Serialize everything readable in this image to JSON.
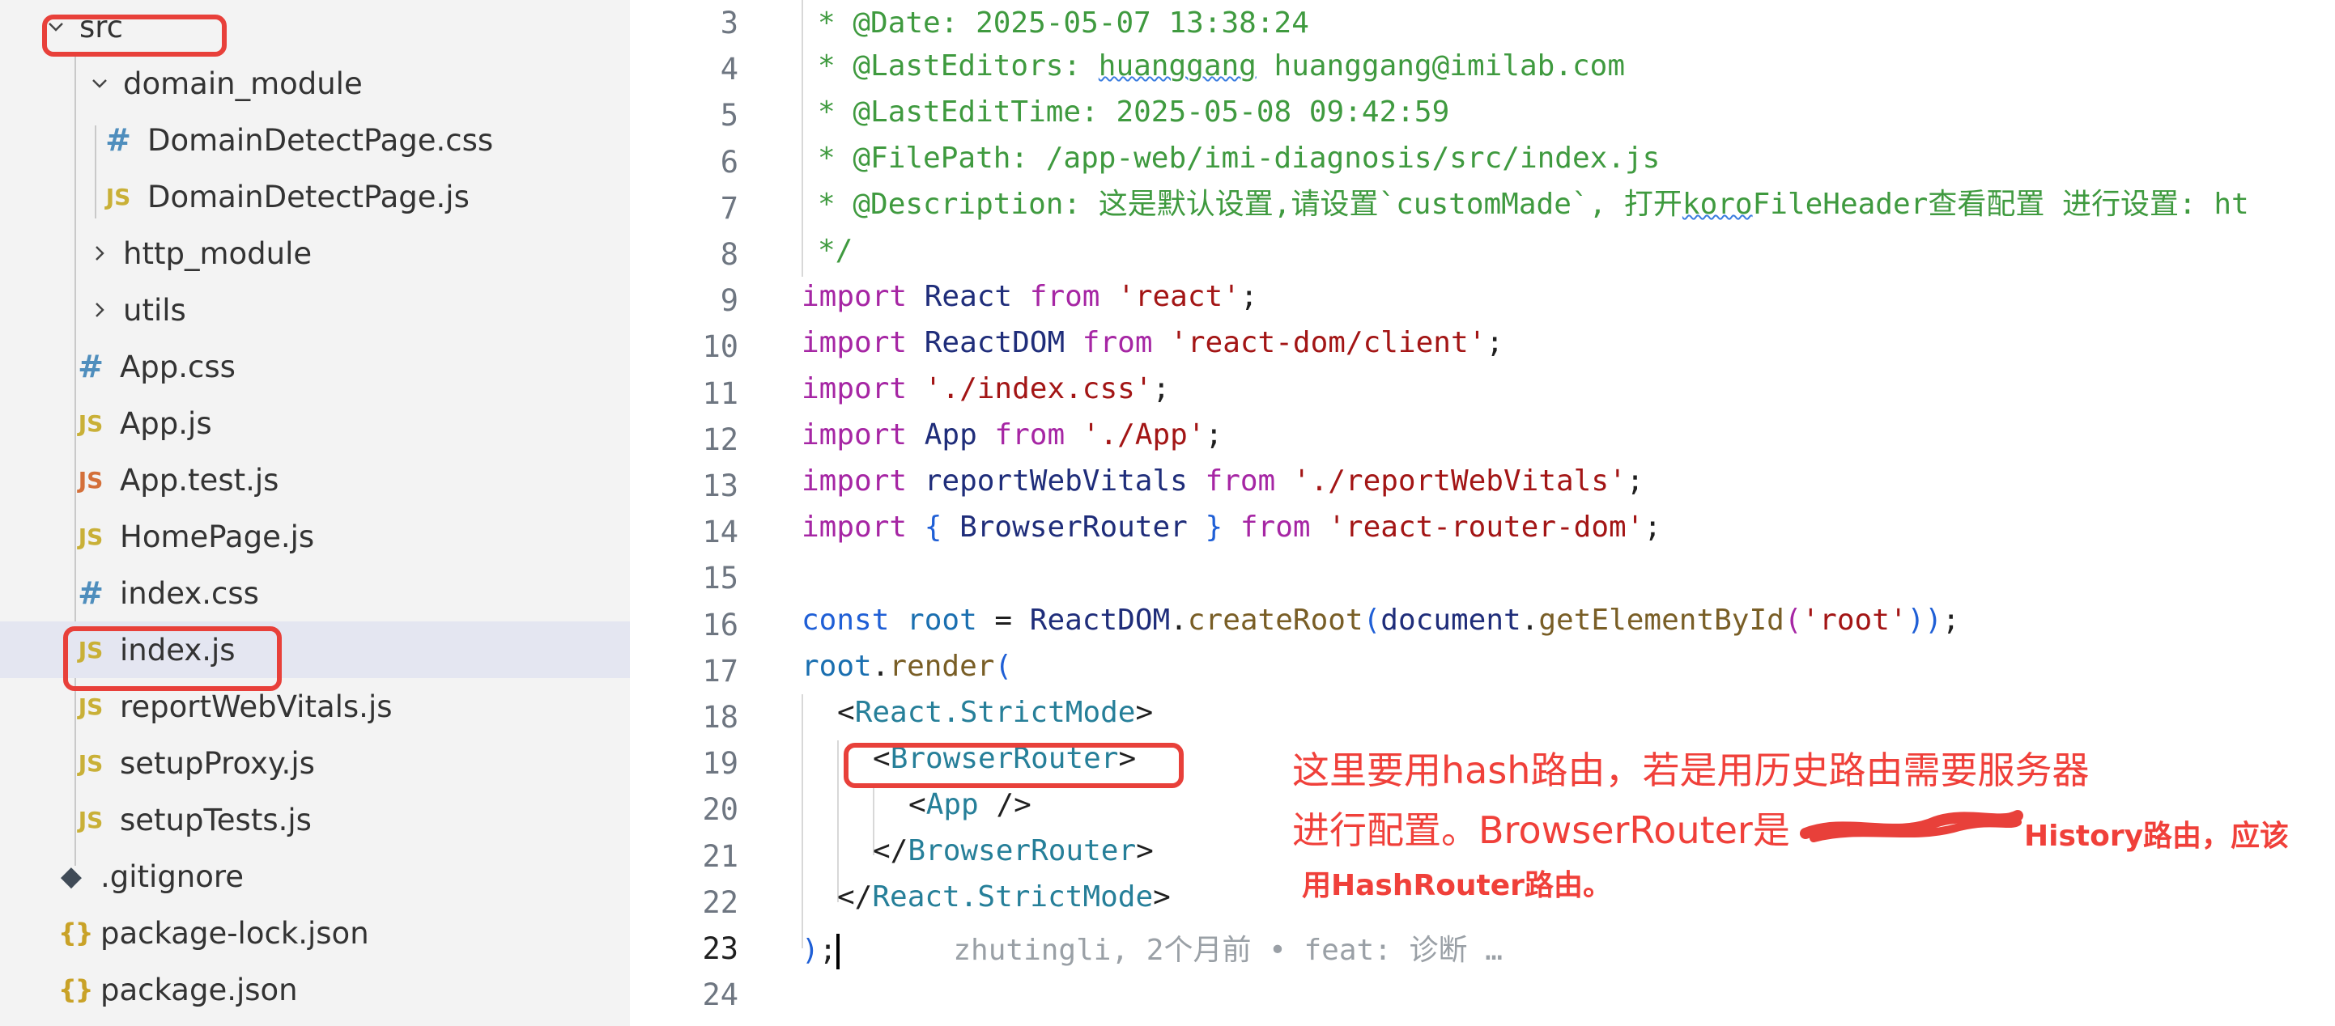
{
  "sidebar": {
    "items": [
      {
        "label": "src",
        "type": "folder-open",
        "icon": "chevron-down-icon"
      },
      {
        "label": "domain_module",
        "type": "folder-open",
        "icon": "chevron-down-icon"
      },
      {
        "label": "DomainDetectPage.css",
        "type": "css",
        "icon": "#"
      },
      {
        "label": "DomainDetectPage.js",
        "type": "js",
        "icon": "JS"
      },
      {
        "label": "http_module",
        "type": "folder-closed",
        "icon": "chevron-right-icon"
      },
      {
        "label": "utils",
        "type": "folder-closed",
        "icon": "chevron-right-icon"
      },
      {
        "label": "App.css",
        "type": "css",
        "icon": "#"
      },
      {
        "label": "App.js",
        "type": "js",
        "icon": "JS"
      },
      {
        "label": "App.test.js",
        "type": "js-test",
        "icon": "JS"
      },
      {
        "label": "HomePage.js",
        "type": "js",
        "icon": "JS"
      },
      {
        "label": "index.css",
        "type": "css",
        "icon": "#"
      },
      {
        "label": "index.js",
        "type": "js",
        "icon": "JS",
        "selected": true
      },
      {
        "label": "reportWebVitals.js",
        "type": "js",
        "icon": "JS"
      },
      {
        "label": "setupProxy.js",
        "type": "js",
        "icon": "JS"
      },
      {
        "label": "setupTests.js",
        "type": "js",
        "icon": "JS"
      },
      {
        "label": ".gitignore",
        "type": "git",
        "icon": "git-icon"
      },
      {
        "label": "package-lock.json",
        "type": "json",
        "icon": "{}"
      },
      {
        "label": "package.json",
        "type": "json",
        "icon": "{}"
      }
    ]
  },
  "editor": {
    "active_line": "23",
    "line_numbers": [
      "3",
      "4",
      "5",
      "6",
      "7",
      "8",
      "9",
      "10",
      "11",
      "12",
      "13",
      "14",
      "15",
      "16",
      "17",
      "18",
      "19",
      "20",
      "21",
      "22",
      "23",
      "24"
    ],
    "lines": {
      "l3": [
        "* @Date: 2025-05-07 13:38:24"
      ],
      "l4": [
        "* @LastEditors: ",
        "huanggang",
        " huanggang@imilab.com"
      ],
      "l5": [
        "* @LastEditTime: 2025-05-08 09:42:59"
      ],
      "l6": [
        "* @FilePath: /app-web/imi-diagnosis/src/index.js"
      ],
      "l7": [
        "* @Description: 这是默认设置,请设置`customMade`, 打开",
        "koro",
        "FileHeader查看配置 进行设置: ht"
      ],
      "l8": [
        "*/"
      ],
      "l9": [
        "import",
        " React ",
        "from",
        " 'react'",
        ";"
      ],
      "l10": [
        "import",
        " ReactDOM ",
        "from",
        " 'react-dom/client'",
        ";"
      ],
      "l11": [
        "import",
        " './index.css'",
        ";"
      ],
      "l12": [
        "import",
        " App ",
        "from",
        " './App'",
        ";"
      ],
      "l13": [
        "import",
        " reportWebVitals ",
        "from",
        " './reportWebVitals'",
        ";"
      ],
      "l14": [
        "import",
        " { ",
        "BrowserRouter",
        " } ",
        "from",
        " 'react-router-dom'",
        ";"
      ],
      "l16": [
        "const",
        " root",
        " = ",
        "ReactDOM",
        ".",
        "createRoot",
        "(",
        "document",
        ".",
        "getElementById",
        "(",
        "'root'",
        "))",
        ";"
      ],
      "l17": [
        "root",
        ".",
        "render",
        "("
      ],
      "l18": [
        "<",
        "React.StrictMode",
        ">"
      ],
      "l19": [
        "<",
        "BrowserRouter",
        ">"
      ],
      "l20": [
        "<",
        "App",
        " />"
      ],
      "l21": [
        "</",
        "BrowserRouter",
        ">"
      ],
      "l22": [
        "</",
        "React.StrictMode",
        ">"
      ],
      "l23": [
        ")",
        ";"
      ],
      "blame": "zhutingli, 2个月前 • feat: 诊断 …"
    }
  },
  "annotation": {
    "line1": "这里要用hash路由，若是用历史路由需要服务器",
    "line2_a": "进行配置。BrowserRouter是",
    "line2_b": "History路由，应该",
    "line3": "用HashRouter路由。"
  },
  "colors": {
    "annotation_red": "#f0403a",
    "sidebar_bg": "#f3f3f3",
    "selected_row": "#e4e6f1"
  }
}
